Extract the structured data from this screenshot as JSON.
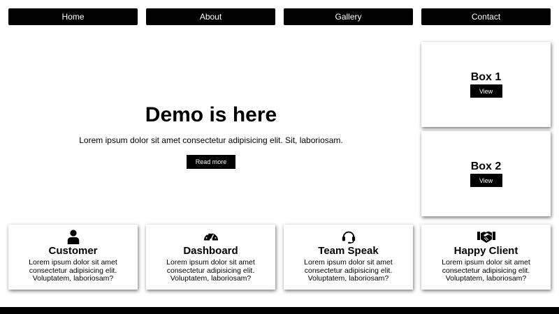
{
  "nav": {
    "items": [
      {
        "label": "Home"
      },
      {
        "label": "About"
      },
      {
        "label": "Gallery"
      },
      {
        "label": "Contact"
      }
    ]
  },
  "hero": {
    "title": "Demo is here",
    "text": "Lorem ipsum dolor sit amet consectetur adipisicing elit. Sit, laboriosam.",
    "button_label": "Read more"
  },
  "side_boxes": [
    {
      "title": "Box 1",
      "button_label": "View"
    },
    {
      "title": "Box 2",
      "button_label": "View"
    }
  ],
  "features": [
    {
      "icon": "user-icon",
      "title": "Customer",
      "text": "Lorem ipsum dolor sit amet consectetur adipisicing elit. Voluptatem, laboriosam?"
    },
    {
      "icon": "speedometer-icon",
      "title": "Dashboard",
      "text": "Lorem ipsum dolor sit amet consectetur adipisicing elit. Voluptatem, laboriosam?"
    },
    {
      "icon": "headset-icon",
      "title": "Team Speak",
      "text": "Lorem ipsum dolor sit amet consectetur adipisicing elit. Voluptatem, laboriosam?"
    },
    {
      "icon": "handshake-icon",
      "title": "Happy Client",
      "text": "Lorem ipsum dolor sit amet consectetur adipisicing elit. Voluptatem, laboriosam?"
    }
  ],
  "colors": {
    "accent": "#000000",
    "background": "#ffffff"
  }
}
